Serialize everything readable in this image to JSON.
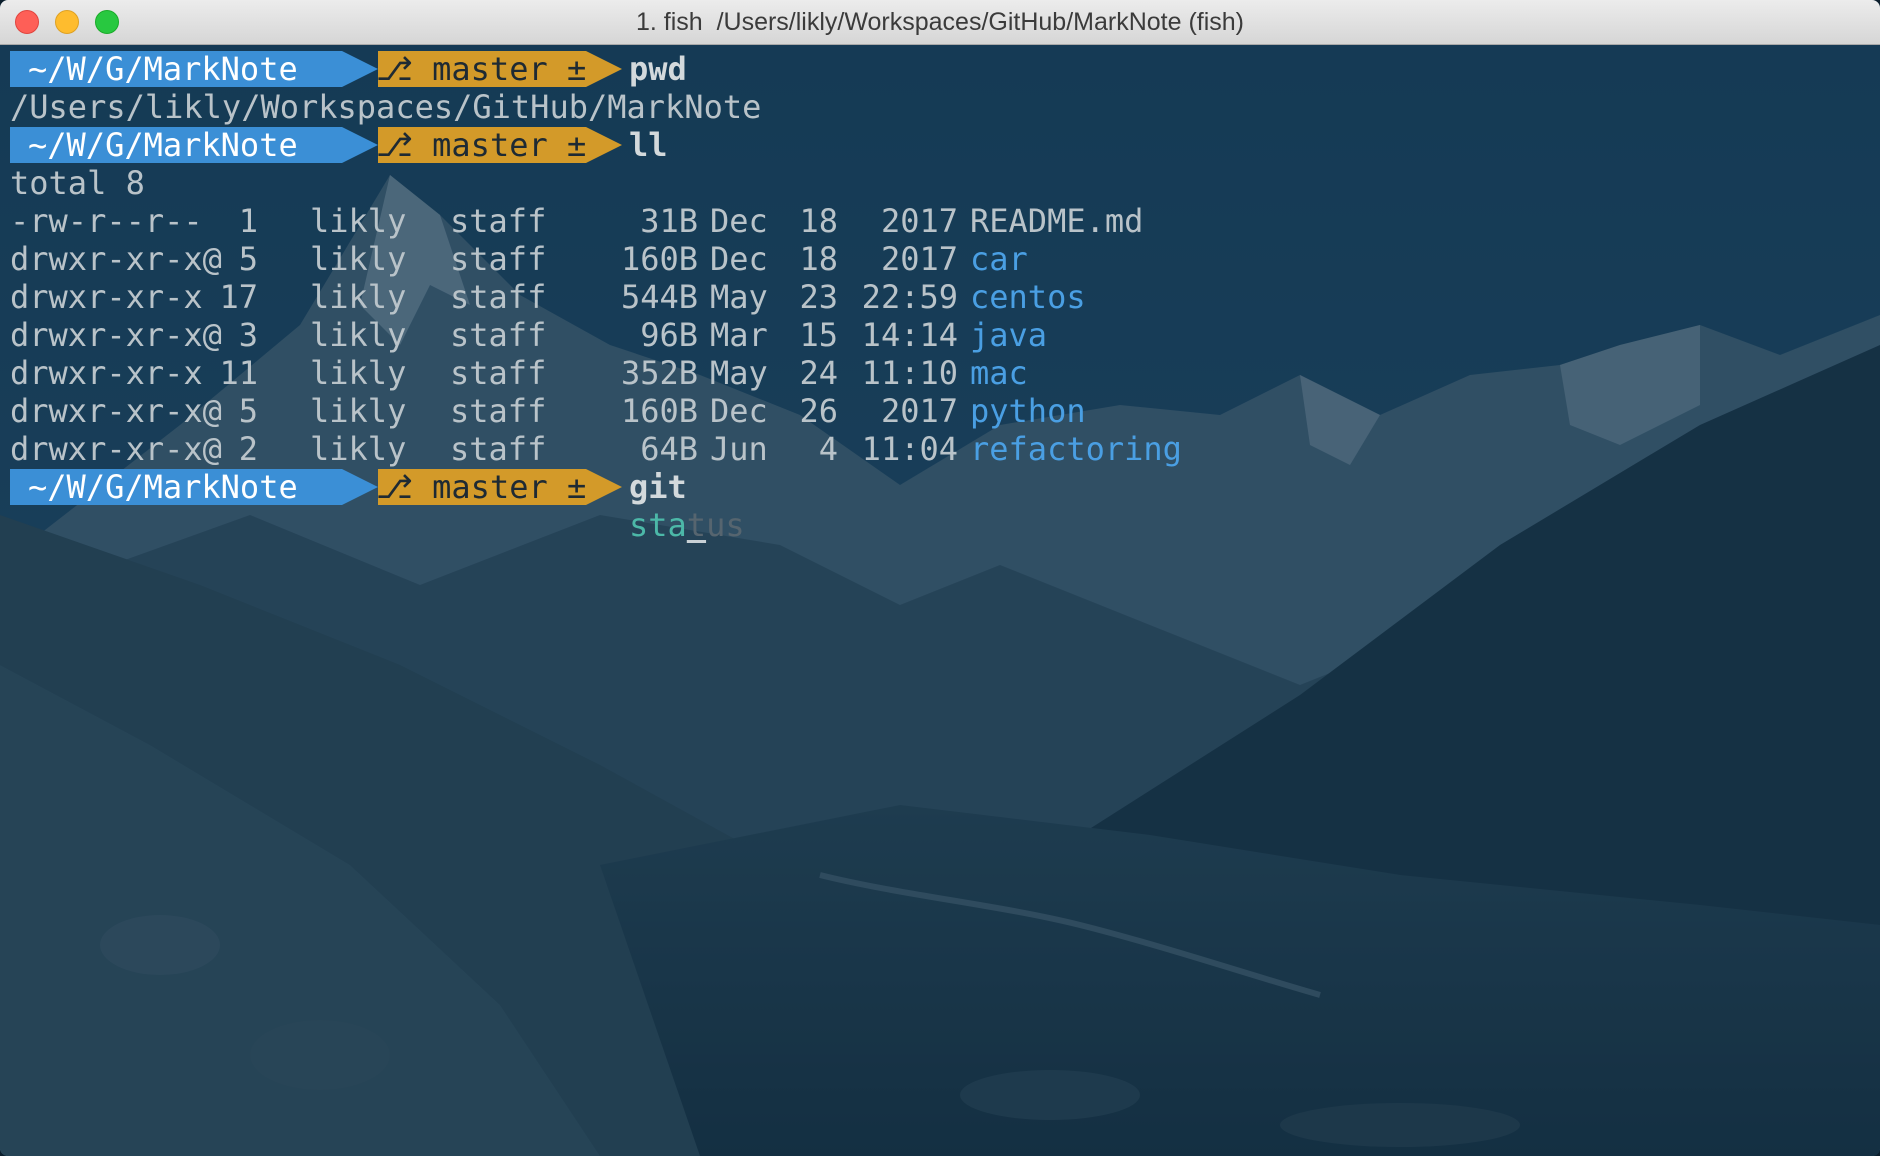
{
  "window": {
    "title": "1. fish  /Users/likly/Workspaces/GitHub/MarkNote (fish)",
    "traffic_lights": [
      "close",
      "minimize",
      "zoom"
    ]
  },
  "colors": {
    "path_segment": "#3b8fd6",
    "git_segment": "#d39a29",
    "directory": "#4a9fe3",
    "command_arg": "#4cb8a8",
    "suggestion": "#56656f"
  },
  "prompt": {
    "path": "~/W/G/MarkNote",
    "branch": "master ±",
    "branch_icon": "branch-icon"
  },
  "commands": {
    "first": "pwd",
    "second": "ll",
    "third_cmd": "git",
    "third_typed_a": "sta",
    "third_typed_b": "t",
    "third_suggestion": "us"
  },
  "pwd_output": "/Users/likly/Workspaces/GitHub/MarkNote",
  "ls_total": "total 8",
  "ls_rows": [
    {
      "perm": "-rw-r--r--",
      "links": "1",
      "owner": "likly",
      "group": "staff",
      "size": "31B",
      "month": "Dec",
      "day": "18",
      "time": "2017",
      "name": "README.md",
      "is_dir": false
    },
    {
      "perm": "drwxr-xr-x@",
      "links": "5",
      "owner": "likly",
      "group": "staff",
      "size": "160B",
      "month": "Dec",
      "day": "18",
      "time": "2017",
      "name": "car",
      "is_dir": true
    },
    {
      "perm": "drwxr-xr-x",
      "links": "17",
      "owner": "likly",
      "group": "staff",
      "size": "544B",
      "month": "May",
      "day": "23",
      "time": "22:59",
      "name": "centos",
      "is_dir": true
    },
    {
      "perm": "drwxr-xr-x@",
      "links": "3",
      "owner": "likly",
      "group": "staff",
      "size": "96B",
      "month": "Mar",
      "day": "15",
      "time": "14:14",
      "name": "java",
      "is_dir": true
    },
    {
      "perm": "drwxr-xr-x",
      "links": "11",
      "owner": "likly",
      "group": "staff",
      "size": "352B",
      "month": "May",
      "day": "24",
      "time": "11:10",
      "name": "mac",
      "is_dir": true
    },
    {
      "perm": "drwxr-xr-x@",
      "links": "5",
      "owner": "likly",
      "group": "staff",
      "size": "160B",
      "month": "Dec",
      "day": "26",
      "time": "2017",
      "name": "python",
      "is_dir": true
    },
    {
      "perm": "drwxr-xr-x@",
      "links": "2",
      "owner": "likly",
      "group": "staff",
      "size": "64B",
      "month": "Jun",
      "day": "4",
      "time": "11:04",
      "name": "refactoring",
      "is_dir": true
    }
  ]
}
